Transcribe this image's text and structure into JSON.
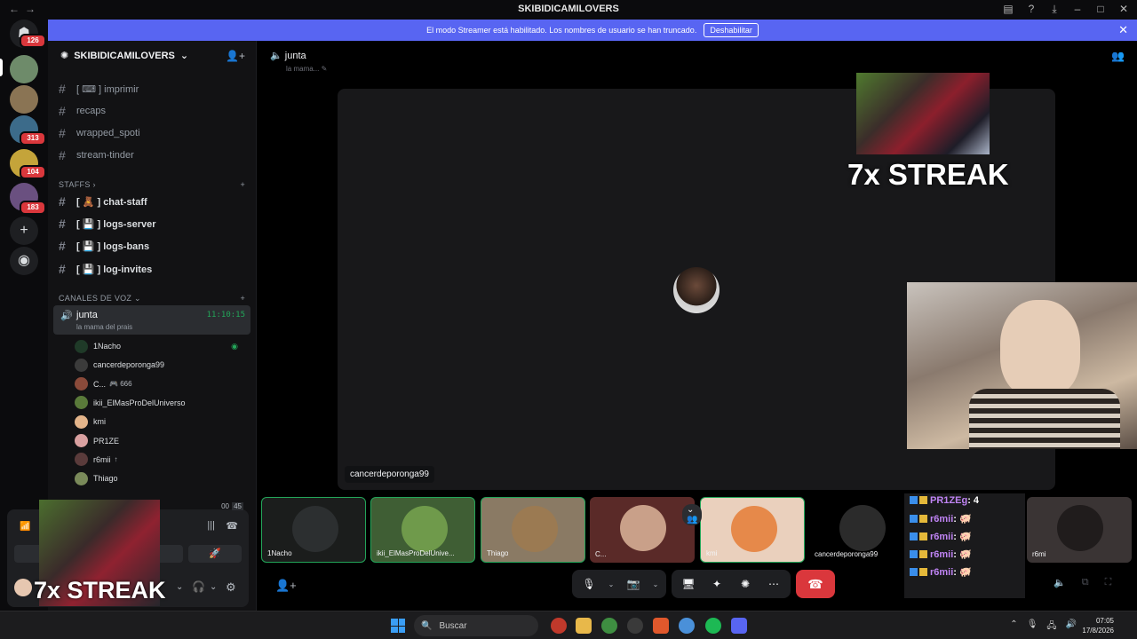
{
  "window": {
    "title": "SKIBIDICAMILOVERS"
  },
  "banner": {
    "text": "El modo Streamer está habilitado. Los nombres de usuario se han truncado.",
    "button": "Deshabilitar"
  },
  "guilds": {
    "badges": [
      "126",
      "313",
      "104",
      "183"
    ]
  },
  "server": {
    "name": "SKIBIDICAMILOVERS"
  },
  "channels": [
    {
      "label": "[ ⌨ ] imprimir"
    },
    {
      "label": "recaps"
    },
    {
      "label": "wrapped_spoti"
    },
    {
      "label": "stream-tinder"
    }
  ],
  "categories": {
    "staffs": "STAFFS",
    "voice": "CANALES DE VOZ"
  },
  "staff_channels": [
    {
      "label": "[ 🧸 ] chat-staff"
    },
    {
      "label": "[ 💾 ] logs-server"
    },
    {
      "label": "[ 💾 ] logs-bans"
    },
    {
      "label": "[ 💾 ] log-invites"
    }
  ],
  "voice_channel": {
    "name": "junta",
    "status": "la mama del prais",
    "timer": "11:10:15"
  },
  "voice_users": [
    {
      "name": "1Nacho",
      "extra": "",
      "color": "#1f3a28"
    },
    {
      "name": "cancerdeporonga99",
      "extra": "",
      "color": "#3b3b3b"
    },
    {
      "name": "C...",
      "extra": "🎮 666",
      "color": "#8a4a3a"
    },
    {
      "name": "ikii_ElMasProDelUniverso",
      "extra": "",
      "color": "#5a7a3a"
    },
    {
      "name": "kmi",
      "extra": "",
      "color": "#e3b48a"
    },
    {
      "name": "PR1ZE",
      "extra": "",
      "color": "#d9a0a0"
    },
    {
      "name": "r6mii",
      "extra": "↑",
      "color": "#5a3b3b"
    },
    {
      "name": "Thiago",
      "extra": "",
      "color": "#7a8a5a"
    }
  ],
  "user_panel": {
    "counter_a": "00",
    "counter_b": "45"
  },
  "main": {
    "channel": "junta",
    "channel_sub": "la mama...",
    "stage_label": "cancerdeporonga99"
  },
  "overlay": {
    "streak": "7x STREAK"
  },
  "tiles": [
    {
      "name": "1Nacho",
      "bg": "#1b1d1c",
      "av": "#2c2f30"
    },
    {
      "name": "ikii_ElMasProDelUnive...",
      "bg": "#3f5e34",
      "av": "#6f9a4b"
    },
    {
      "name": "Thiago",
      "bg": "#8a7a64",
      "av": "#9b7a52"
    },
    {
      "name": "C...",
      "bg": "#5a2a28",
      "av": "#c9a089"
    },
    {
      "name": "kmi",
      "bg": "#ead0bd",
      "av": "#e6894a"
    },
    {
      "name": "cancerdeporonga99",
      "bg": "#000000",
      "av": "#2b2b2b"
    },
    {
      "name": "r6mi",
      "bg": "#3a3434",
      "av": "#201c1c"
    }
  ],
  "chat": [
    {
      "user": "PR1ZEg",
      "msg": ": 4"
    },
    {
      "user": "r6mii",
      "msg": ": 🐖"
    },
    {
      "user": "r6mii",
      "msg": ": 🐖"
    },
    {
      "user": "r6mii",
      "msg": ": 🐖"
    },
    {
      "user": "r6mii",
      "msg": ": 🐖"
    }
  ],
  "taskbar": {
    "search": "Buscar",
    "time": "07:05",
    "date": "17/8/2026"
  },
  "colors": {
    "accent": "#5865f2",
    "danger": "#da373c",
    "online": "#23a559"
  }
}
